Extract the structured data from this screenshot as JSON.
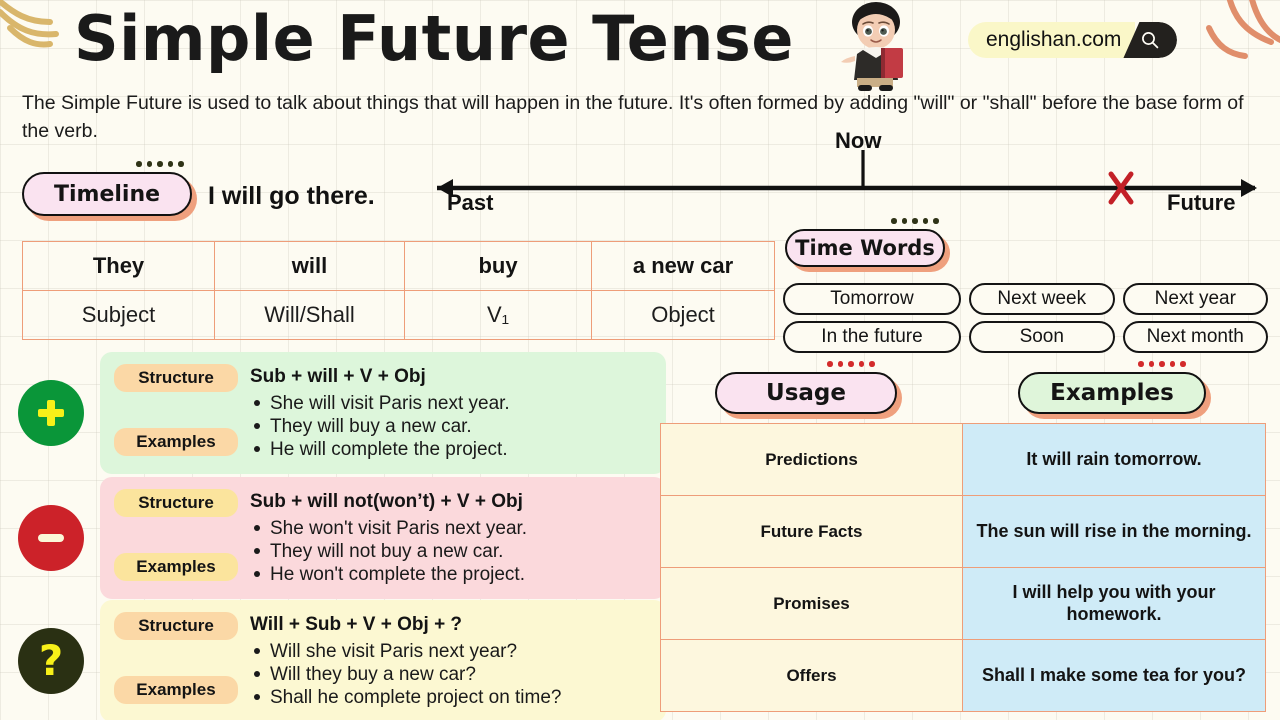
{
  "header": {
    "title": "Simple Future Tense",
    "logo_text": "englishan.com",
    "search_icon": "search-icon",
    "mascot": "boy-with-book-mascot",
    "intro": "The Simple Future is used to talk about things that will happen in the future. It's often formed by adding \"will\" or \"shall\" before the base form of the verb."
  },
  "timeline": {
    "badge_label": "Timeline",
    "example_sentence": "I will go there.",
    "past_label": "Past",
    "now_label": "Now",
    "future_label": "Future",
    "marker": "X"
  },
  "structure_table": {
    "example_row": [
      "They",
      "will",
      "buy",
      "a new car"
    ],
    "label_row": [
      "Subject",
      "Will/Shall",
      "V₁",
      "Object"
    ]
  },
  "time_words": {
    "badge_label": "Time Words",
    "items": [
      "Tomorrow",
      "Next week",
      "Next year",
      "In the future",
      "Soon",
      "Next month"
    ]
  },
  "forms": [
    {
      "type": "positive",
      "icon": "plus-icon",
      "structure_label": "Structure",
      "examples_label": "Examples",
      "structure": "Sub + will + V + Obj",
      "examples": [
        "She will visit Paris next year.",
        "They will buy a new car.",
        "He will complete the project."
      ]
    },
    {
      "type": "negative",
      "icon": "minus-icon",
      "structure_label": "Structure",
      "examples_label": "Examples",
      "structure": "Sub + will not(won’t) + V + Obj",
      "examples": [
        "She won't visit Paris next year.",
        "They will not buy a new car.",
        "He won't complete the project."
      ]
    },
    {
      "type": "interrogative",
      "icon": "question-mark-icon",
      "structure_label": "Structure",
      "examples_label": "Examples",
      "structure": "Will + Sub + V + Obj + ?",
      "examples": [
        "Will she visit Paris next year?",
        "Will they buy a new car?",
        "Shall he complete project on time?"
      ]
    }
  ],
  "usage_section": {
    "usage_badge": "Usage",
    "examples_badge": "Examples",
    "rows": [
      {
        "usage": "Predictions",
        "example": "It will rain tomorrow."
      },
      {
        "usage": "Future Facts",
        "example": "The sun will rise in the morning."
      },
      {
        "usage": "Promises",
        "example": "I will help you with your homework."
      },
      {
        "usage": "Offers",
        "example": "Shall I make some tea for you?"
      }
    ]
  },
  "colors": {
    "background": "#FDFBF2",
    "positive": "#0A9639",
    "negative": "#CC2229",
    "interrogative": "#2A3013",
    "table_border": "#EE9D79",
    "badge_pink": "#FAE3F0",
    "badge_green": "#DFF5DA",
    "usage_key_bg": "#FDF7DE",
    "usage_value_bg": "#CFEBF7",
    "marker_red": "#C32027",
    "shadow_orange": "#EFA07E"
  }
}
